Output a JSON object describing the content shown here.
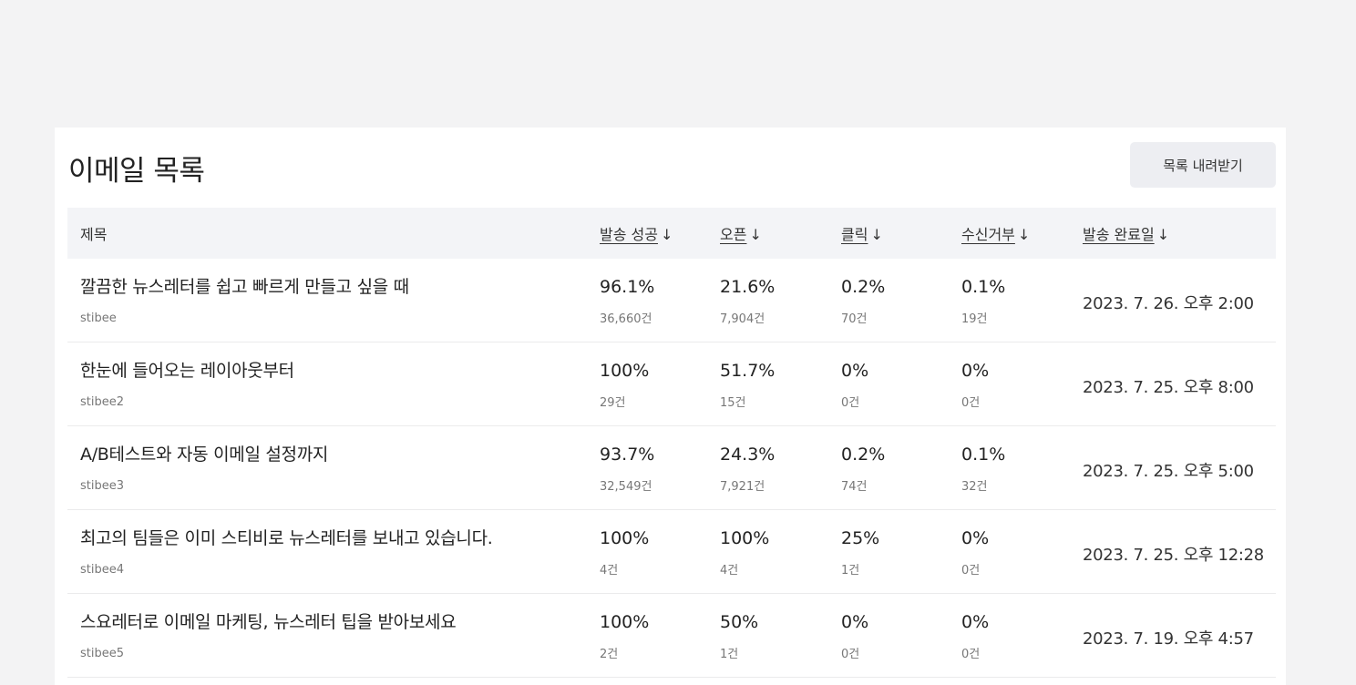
{
  "panel": {
    "title": "이메일 목록",
    "download_label": "목록 내려받기"
  },
  "table": {
    "headers": {
      "title": "제목",
      "sent": "발송 성공",
      "open": "오픈",
      "click": "클릭",
      "unsub": "수신거부",
      "date": "발송 완료일",
      "sort_arrow": "↓"
    },
    "rows": [
      {
        "subject": "깔끔한 뉴스레터를 쉽고 빠르게 만들고 싶을 때",
        "sender": "stibee",
        "sent_pct": "96.1%",
        "sent_count": "36,660건",
        "open_pct": "21.6%",
        "open_count": "7,904건",
        "click_pct": "0.2%",
        "click_count": "70건",
        "unsub_pct": "0.1%",
        "unsub_count": "19건",
        "date": "2023. 7. 26. 오후 2:00"
      },
      {
        "subject": "한눈에 들어오는 레이아웃부터",
        "sender": "stibee2",
        "sent_pct": "100%",
        "sent_count": "29건",
        "open_pct": "51.7%",
        "open_count": "15건",
        "click_pct": "0%",
        "click_count": "0건",
        "unsub_pct": "0%",
        "unsub_count": "0건",
        "date": "2023. 7. 25. 오후 8:00"
      },
      {
        "subject": "A/B테스트와 자동 이메일 설정까지",
        "sender": "stibee3",
        "sent_pct": "93.7%",
        "sent_count": "32,549건",
        "open_pct": "24.3%",
        "open_count": "7,921건",
        "click_pct": "0.2%",
        "click_count": "74건",
        "unsub_pct": "0.1%",
        "unsub_count": "32건",
        "date": "2023. 7. 25. 오후 5:00"
      },
      {
        "subject": "최고의 팀들은 이미 스티비로 뉴스레터를 보내고 있습니다.",
        "sender": "stibee4",
        "sent_pct": "100%",
        "sent_count": "4건",
        "open_pct": "100%",
        "open_count": "4건",
        "click_pct": "25%",
        "click_count": "1건",
        "unsub_pct": "0%",
        "unsub_count": "0건",
        "date": "2023. 7. 25. 오후 12:28"
      },
      {
        "subject": "스요레터로 이메일 마케팅, 뉴스레터 팁을 받아보세요",
        "sender": "stibee5",
        "sent_pct": "100%",
        "sent_count": "2건",
        "open_pct": "50%",
        "open_count": "1건",
        "click_pct": "0%",
        "click_count": "0건",
        "unsub_pct": "0%",
        "unsub_count": "0건",
        "date": "2023. 7. 19. 오후 4:57"
      }
    ]
  }
}
